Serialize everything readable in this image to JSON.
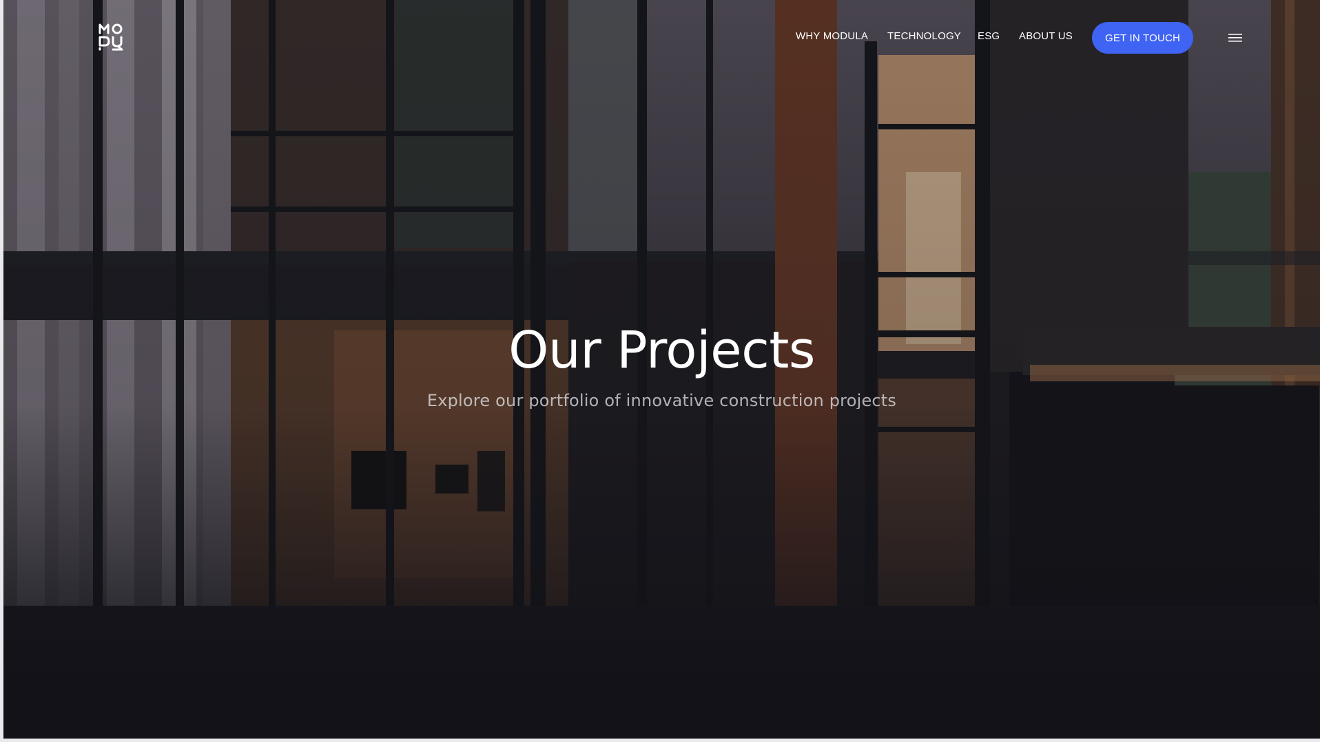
{
  "nav": {
    "logo_alt": "MODULA",
    "links": [
      {
        "label": "WHY MODULA"
      },
      {
        "label": "TECHNOLOGY"
      },
      {
        "label": "ESG"
      },
      {
        "label": "ABOUT US"
      }
    ],
    "cta_label": "GET IN TOUCH",
    "menu_icon": "hamburger-menu-icon"
  },
  "hero": {
    "title": "Our Projects",
    "subtitle": "Explore our portfolio of innovative construction projects"
  },
  "colors": {
    "accent": "#3f63f3",
    "text": "#ffffff",
    "background": "#14141b"
  }
}
